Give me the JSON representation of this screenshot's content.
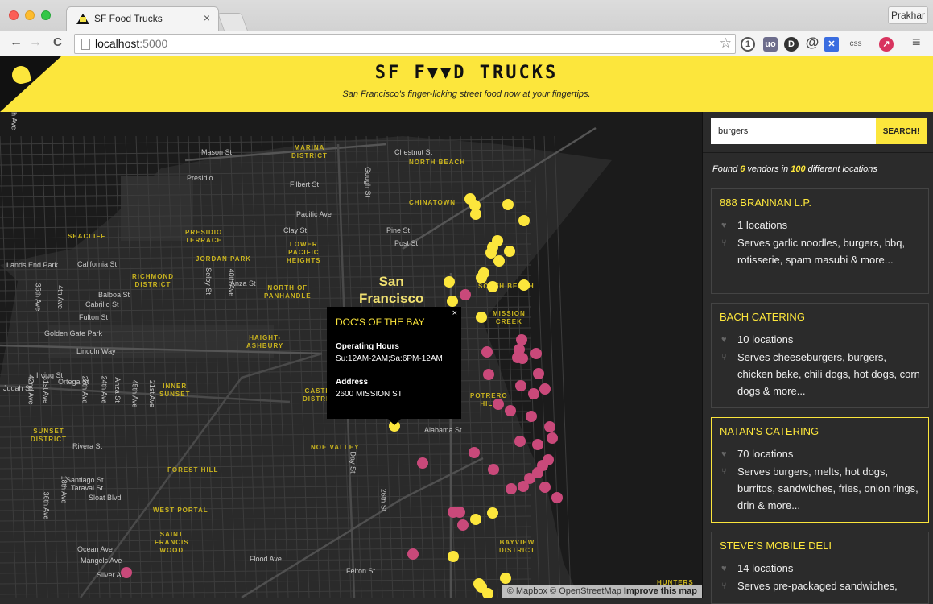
{
  "browser": {
    "tab_title": "SF Food Trucks",
    "tab_close": "×",
    "profile": "Prakhar",
    "url_host": "localhost",
    "url_port": ":5000",
    "extensions": [
      "1",
      "uo",
      "D",
      "@",
      "✕",
      "css",
      "↗"
    ]
  },
  "header": {
    "brand": "SF F▼▼D TRUCKS",
    "tagline": "San Francisco's finger-licking street food now at your fingertips."
  },
  "map": {
    "city": "San\nFrancisco",
    "attribution_text": "© Mapbox © OpenStreetMap",
    "attribution_link": "Improve this map",
    "streets": [
      "Mason St",
      "Chestnut St",
      "Filbert St",
      "Gough St",
      "Pacific Ave",
      "Clay St",
      "Pine St",
      "Post St",
      "Lands End Park",
      "California St",
      "Anza St",
      "Balboa St",
      "Cabrillo St",
      "Fulton St",
      "Golden Gate Park",
      "Lincoln Way",
      "Irving St",
      "Judah St",
      "Ortega St",
      "Rivera St",
      "Santiago St",
      "Taraval St",
      "Sloat Blvd",
      "Ocean Ave",
      "Mangels Ave",
      "Flood Ave",
      "Silver Ave",
      "Felton St",
      "26th St",
      "Day St",
      "Alabama St",
      "Selby St",
      "4th Ave",
      "35th Ave",
      "40th Ave",
      "Anza St",
      "24th Ave",
      "28th Ave",
      "31st Ave",
      "42nd Ave",
      "45th Ave",
      "21st Ave",
      "18th Ave",
      "36th Ave",
      "40th Ave"
    ],
    "districts": [
      "MARINA\nDISTRICT",
      "NORTH BEACH",
      "CHINATOWN",
      "PRESIDIO\nTERRACE",
      "SEACLIFF",
      "JORDAN PARK",
      "LOWER\nPACIFIC\nHEIGHTS",
      "RICHMOND\nDISTRICT",
      "NORTH OF\nPANHANDLE",
      "SOUTH BEACH",
      "MISSION\nCREEK",
      "HAIGHT-\nASHBURY",
      "INNER\nSUNSET",
      "CASTRO\nDISTRICT",
      "POTRERO\nHILL",
      "SUNSET\nDISTRICT",
      "NOE VALLEY",
      "FOREST HILL",
      "WEST PORTAL",
      "SAINT\nFRANCIS\nWOOD",
      "BAYVIEW\nDISTRICT",
      "HUNTERS",
      "Presidio"
    ],
    "marker_yellow": "#fce63c",
    "marker_pink": "#c9497a"
  },
  "popup": {
    "close": "×",
    "title": "DOC'S OF THE BAY",
    "hours_label": "Operating Hours",
    "hours_value": "Su:12AM-2AM;Sa:6PM-12AM",
    "address_label": "Address",
    "address_value": "2600 MISSION ST"
  },
  "sidebar": {
    "search_value": "burgers",
    "search_button": "SEARCH!",
    "found_prefix": "Found ",
    "found_vendors": "6",
    "found_middle": " vendors in ",
    "found_locations": "100",
    "found_suffix": " different locations",
    "vendors": [
      {
        "name": "888 BRANNAN L.P.",
        "locations": "1 locations",
        "serves": "Serves garlic noodles, burgers, bbq, rotisserie, spam masubi & more..."
      },
      {
        "name": "BACH CATERING",
        "locations": "10 locations",
        "serves": "Serves cheeseburgers, burgers, chicken bake, chili dogs, hot dogs, corn dogs & more..."
      },
      {
        "name": "NATAN'S CATERING",
        "locations": "70 locations",
        "serves": "Serves burgers, melts, hot dogs, burritos, sandwiches, fries, onion rings, drin & more..."
      },
      {
        "name": "STEVE'S MOBILE DELI",
        "locations": "14 locations",
        "serves": "Serves pre-packaged sandwiches,"
      }
    ]
  },
  "colors": {
    "accent": "#fce63c",
    "dark": "#2b2b2b",
    "map_bg": "#262626"
  }
}
